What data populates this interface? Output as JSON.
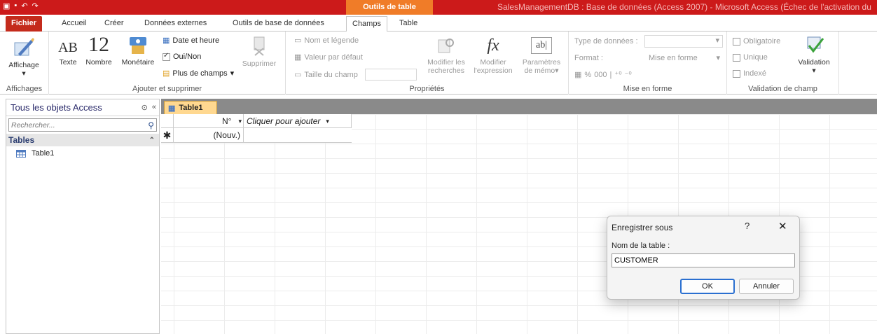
{
  "titlebar": {
    "contextual_group": "Outils de table",
    "window_title": "SalesManagementDB : Base de données (Access 2007) - Microsoft Access (Échec de l'activation du"
  },
  "ribbon_tabs": [
    "Fichier",
    "Accueil",
    "Créer",
    "Données externes",
    "Outils de base de données",
    "Champs",
    "Table"
  ],
  "ribbon": {
    "views": {
      "affichage": "Affichage",
      "group": "Affichages"
    },
    "add_delete": {
      "texte": "Texte",
      "nombre": "Nombre",
      "monetaire": "Monétaire",
      "date_heure": "Date et heure",
      "oui_non": "Oui/Non",
      "plus_champs": "Plus de champs",
      "supprimer": "Supprimer",
      "group": "Ajouter et supprimer",
      "icon_ab": "AB",
      "icon_12": "12"
    },
    "properties": {
      "nom_legende": "Nom et légende",
      "valeur_defaut": "Valeur par défaut",
      "taille_champ": "Taille du champ",
      "modifier_recherches_1": "Modifier les",
      "modifier_recherches_2": "recherches",
      "modifier_expression_1": "Modifier",
      "modifier_expression_2": "l'expression",
      "parametres_memo_1": "Paramètres",
      "parametres_memo_2": "de mémo",
      "group": "Propriétés"
    },
    "formatting": {
      "type_donnees": "Type de données :",
      "format": "Format :",
      "mise_en_forme_value": "Mise en forme",
      "percent": "%",
      "thousands": "000",
      "group": "Mise en forme"
    },
    "validation": {
      "obligatoire": "Obligatoire",
      "unique": "Unique",
      "indexe": "Indexé",
      "validation": "Validation",
      "group": "Validation de champ"
    }
  },
  "nav_pane": {
    "title": "Tous les objets Access",
    "search_placeholder": "Rechercher...",
    "section": "Tables",
    "items": [
      {
        "label": "Table1"
      }
    ]
  },
  "document": {
    "tab_label": "Table1",
    "columns": [
      {
        "label": "N°"
      },
      {
        "label": "Cliquer pour ajouter"
      }
    ],
    "new_row_marker": "✱",
    "new_row_value": "(Nouv.)"
  },
  "dialog": {
    "title": "Enregistrer sous",
    "help": "?",
    "close": "✕",
    "label": "Nom de la table :",
    "value": "CUSTOMER",
    "ok": "OK",
    "cancel": "Annuler"
  }
}
